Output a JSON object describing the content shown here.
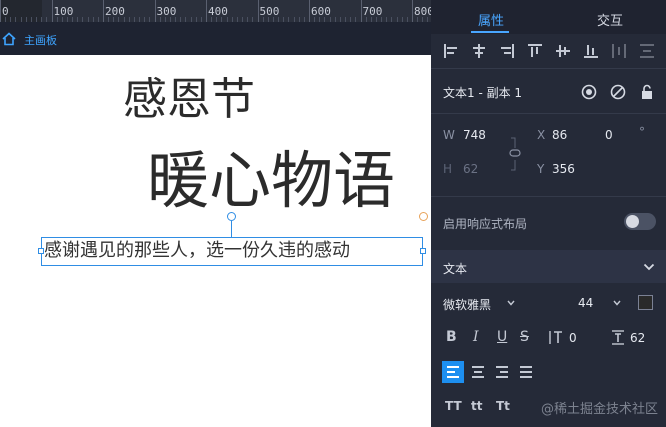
{
  "ruler": {
    "ticks": [
      "0",
      "100",
      "200",
      "300",
      "400",
      "500",
      "600",
      "700",
      "800"
    ]
  },
  "breadcrumb": {
    "home_icon": "home-icon",
    "label": "主画板"
  },
  "canvas": {
    "text1": "感恩节",
    "text2": "暖心物语",
    "text3": "感谢遇见的那些人，选一份久违的感动"
  },
  "panel": {
    "tabs": [
      "属性",
      "交互"
    ],
    "align_icons": [
      "align-left-icon",
      "align-center-h-icon",
      "align-right-icon",
      "align-top-icon",
      "align-middle-v-icon",
      "align-bottom-icon",
      "distribute-h-icon",
      "distribute-v-icon"
    ],
    "layer_name": "文本1 - 副本 1",
    "layer_icons": [
      "eye-icon",
      "disable-icon",
      "unlock-icon"
    ],
    "geometry": {
      "w_label": "W",
      "w_value": "748",
      "x_label": "X",
      "x_value": "86",
      "rotation_value": "0",
      "rotation_unit": "°",
      "h_label": "H",
      "h_value": "62",
      "y_label": "Y",
      "y_value": "356"
    },
    "responsive_label": "启用响应式布局",
    "responsive_enabled": false,
    "text_section": "文本",
    "font_family": "微软雅黑",
    "font_size": "44",
    "font_color": "#2a2a2a",
    "format_buttons": [
      "B",
      "I",
      "U",
      "S"
    ],
    "letter_spacing_value": "0",
    "line_height_value": "62",
    "case_buttons": [
      "TT",
      "tt",
      "Tt"
    ],
    "watermark": "@稀土掘金技术社区"
  },
  "colors": {
    "accent": "#49a6ff",
    "selection": "#2f8de4",
    "panel_bg": "#252a38"
  }
}
